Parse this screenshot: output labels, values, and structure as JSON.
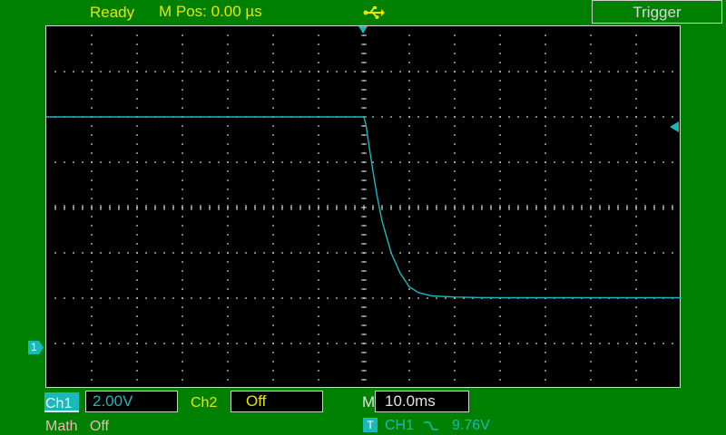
{
  "status": {
    "state": "Ready",
    "mpos": "M Pos: 0.00 µs",
    "usb_icon": "usb-icon"
  },
  "trigger_panel": {
    "title": "Trigger"
  },
  "markers": {
    "ch1_ground": "1"
  },
  "bottom": {
    "ch1_label": "Ch1",
    "ch1_scale": "2.00V",
    "ch2_label": "Ch2",
    "ch2_state": "Off",
    "m_label": "M",
    "timebase": "10.0ms",
    "math_label": "Math",
    "math_state": "Off",
    "t_badge": "T",
    "trig_source": "CH1",
    "trig_edge_icon": "falling-edge-icon",
    "trig_level": "9.76V"
  },
  "colors": {
    "background": "#008000",
    "screen": "#000000",
    "trace": "#1ab9b9",
    "status_text": "#e6e600",
    "grid": "#e0e0e0"
  },
  "chart_data": {
    "type": "line",
    "grid": true,
    "x_divisions": 14,
    "y_divisions": 8,
    "xlim": [
      -70,
      70
    ],
    "ylim": [
      -8,
      8
    ],
    "series": [
      {
        "x": [
          -70,
          -60,
          -50,
          -40,
          -30,
          -20,
          -10,
          0,
          0.5,
          1,
          2,
          3,
          4,
          6,
          8,
          10,
          12,
          15,
          20,
          25,
          30,
          40,
          50,
          60,
          70
        ],
        "y": [
          4.0,
          4.0,
          4.0,
          4.0,
          4.0,
          4.0,
          4.0,
          4.0,
          3.6,
          2.9,
          1.6,
          0.4,
          -0.6,
          -2.0,
          -2.9,
          -3.5,
          -3.75,
          -3.9,
          -3.95,
          -3.97,
          -3.98,
          -3.98,
          -3.98,
          -3.98,
          -3.98
        ]
      }
    ]
  }
}
